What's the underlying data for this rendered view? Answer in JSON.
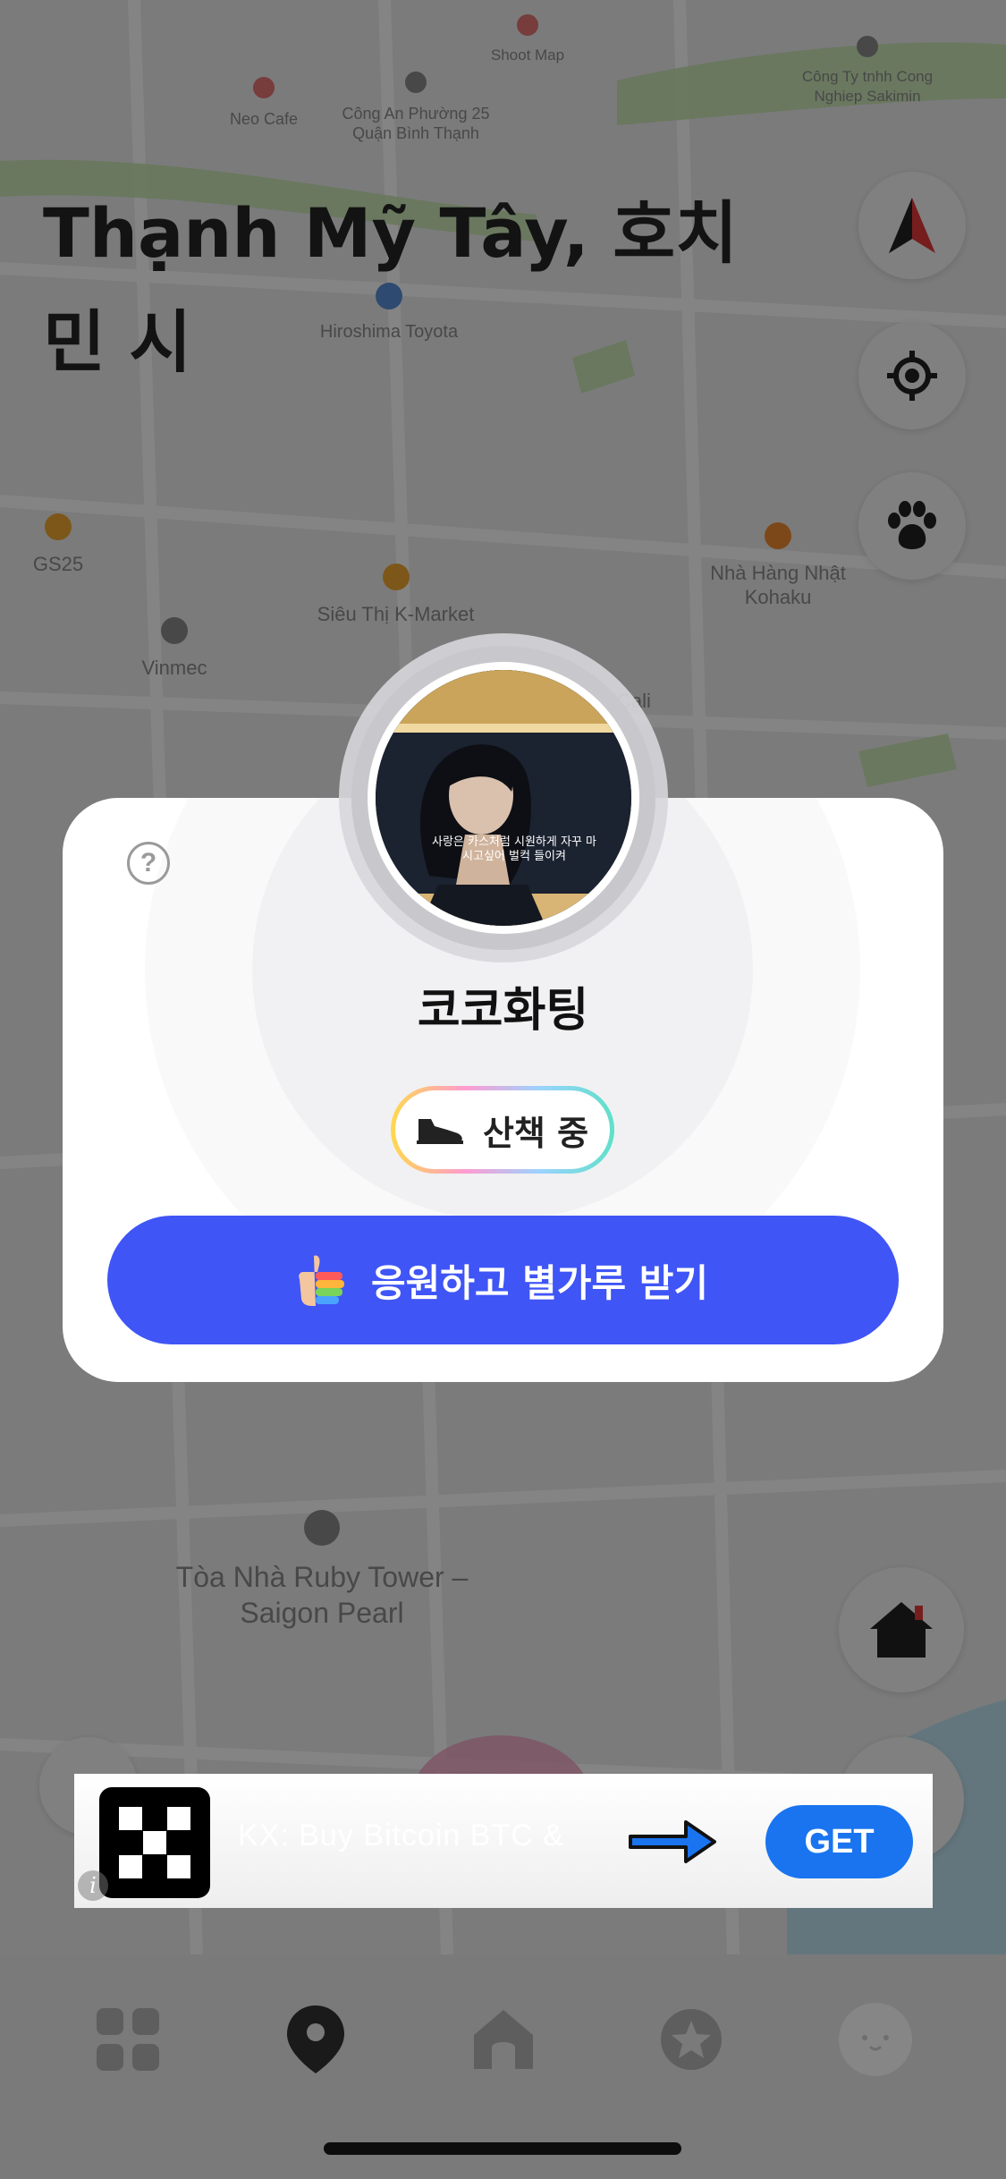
{
  "map": {
    "title": "Thạnh Mỹ Tây, 호치민 시",
    "pois": [
      {
        "label": "Shoot Map",
        "color": "#e57373"
      },
      {
        "label": "Neo Cafe",
        "color": "#e57373"
      },
      {
        "label": "Công An Phường 25 Quận Bình Thạnh",
        "color": "#8a8a8a"
      },
      {
        "label": "Công Ty tnhh Cong Nghiep Sakimin",
        "color": "#8a8a8a"
      },
      {
        "label": "Hiroshima Toyota",
        "color": "#5a8fd6"
      },
      {
        "label": "GS25",
        "color": "#f0a830"
      },
      {
        "label": "Siêu Thị K-Market",
        "color": "#f0a830"
      },
      {
        "label": "Nhà Hàng Nhật Kohaku",
        "color": "#f08a30"
      },
      {
        "label": "Vinmec",
        "color": "#8a8a8a"
      },
      {
        "label": "Cali",
        "color": "#8a8a8a"
      },
      {
        "label": "Tòa Nhà Ruby Tower – Saigon Pearl",
        "color": "#8a8a8a"
      }
    ],
    "controls": [
      "navigation-arrow-icon",
      "locate-icon",
      "paw-icon",
      "home-icon"
    ]
  },
  "popup": {
    "help_icon": "?",
    "name": "코코화팅",
    "photo_caption": "사랑은 카스처럼 시원하게 자꾸 마시고싶어 벌컥 들이켜",
    "status_label": "산책 중",
    "status_icon": "sneaker-icon",
    "cheer_label": "응원하고 별가루 받기",
    "cheer_icon": "thumbs-up-icon"
  },
  "ad": {
    "text": "KX: Buy Bitcoin BTC &",
    "cta": "GET",
    "info_icon": "i",
    "accent": "#1a74f0"
  },
  "tabbar": {
    "items": [
      "grid-icon",
      "map-pin-icon",
      "home-icon",
      "star-badge-icon",
      "dog-face-icon"
    ],
    "active_index": 1
  },
  "colors": {
    "primary_button": "#3f55f6",
    "scrim": "rgba(0,0,0,0.48)"
  }
}
